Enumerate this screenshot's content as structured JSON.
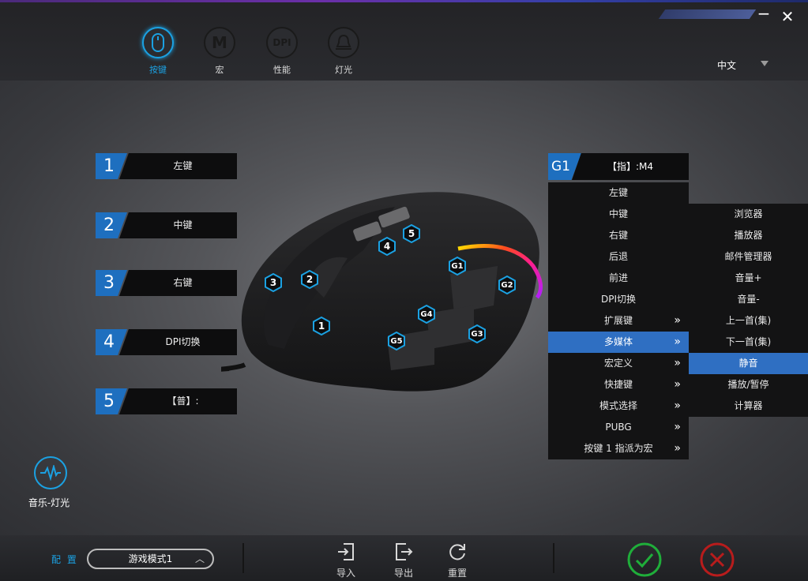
{
  "window": {
    "minimize": "−",
    "close": "✕"
  },
  "nav": [
    {
      "label": "按键",
      "icon": "mouse-icon",
      "active": true
    },
    {
      "label": "宏",
      "icon_text": "M"
    },
    {
      "label": "性能",
      "icon_text": "DPI"
    },
    {
      "label": "灯光",
      "icon": "bell-light-icon"
    }
  ],
  "language": {
    "value": "中文"
  },
  "left_slots": [
    {
      "num": "1",
      "value": "左键"
    },
    {
      "num": "2",
      "value": "中键"
    },
    {
      "num": "3",
      "value": "右键"
    },
    {
      "num": "4",
      "value": "DPI切换"
    },
    {
      "num": "5",
      "value": "【普】:"
    }
  ],
  "markers": [
    "1",
    "2",
    "3",
    "4",
    "5",
    "G1",
    "G2",
    "G3",
    "G4",
    "G5"
  ],
  "g1": {
    "num": "G1",
    "value": "【指】:M4"
  },
  "main_menu": [
    {
      "label": "左键"
    },
    {
      "label": "中键"
    },
    {
      "label": "右键"
    },
    {
      "label": "后退"
    },
    {
      "label": "前进"
    },
    {
      "label": "DPI切换"
    },
    {
      "label": "扩展键",
      "arrow": "»"
    },
    {
      "label": "多媒体",
      "arrow": "»",
      "selected": true
    },
    {
      "label": "宏定义",
      "arrow": "»"
    },
    {
      "label": "快捷键",
      "arrow": "»"
    },
    {
      "label": "模式选择",
      "arrow": "»"
    },
    {
      "label": "PUBG",
      "arrow": "»"
    },
    {
      "label": "按键 1 指派为宏",
      "arrow": "»"
    }
  ],
  "sub_menu": [
    {
      "label": "浏览器"
    },
    {
      "label": "播放器"
    },
    {
      "label": "邮件管理器"
    },
    {
      "label": "音量+"
    },
    {
      "label": "音量-"
    },
    {
      "label": "上一首(集)"
    },
    {
      "label": "下一首(集)"
    },
    {
      "label": "静音",
      "selected": true
    },
    {
      "label": "播放/暂停"
    },
    {
      "label": "计算器"
    }
  ],
  "music_light": {
    "label": "音乐-灯光"
  },
  "bottom": {
    "config_label": "配 置",
    "profile": "游戏模式1",
    "import": "导入",
    "export": "导出",
    "reset": "重置"
  },
  "colors": {
    "accent": "#1ba1e2",
    "slot_blue": "#1e6fbf",
    "selected": "#2f6fc2",
    "confirm": "#1fae3a",
    "cancel": "#b81c1c"
  }
}
